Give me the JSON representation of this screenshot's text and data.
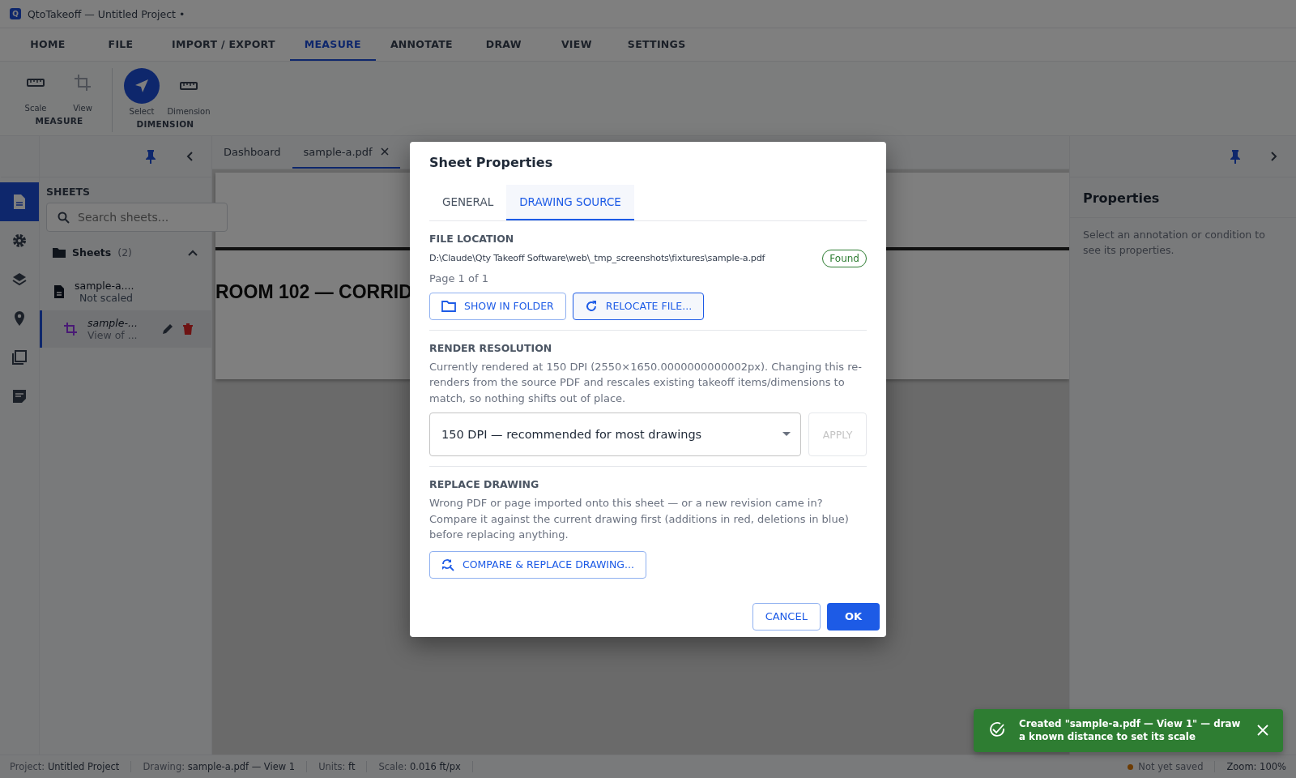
{
  "app": {
    "title": "QtoTakeoff — Untitled Project •",
    "logo": "Q"
  },
  "menu_tabs": [
    {
      "label": "HOME",
      "selected": false
    },
    {
      "label": "FILE",
      "selected": false
    },
    {
      "label": "IMPORT / EXPORT",
      "selected": false
    },
    {
      "label": "MEASURE",
      "selected": true
    },
    {
      "label": "ANNOTATE",
      "selected": false
    },
    {
      "label": "DRAW",
      "selected": false
    },
    {
      "label": "VIEW",
      "selected": false
    },
    {
      "label": "SETTINGS",
      "selected": false
    }
  ],
  "ribbon": [
    {
      "label": "MEASURE",
      "tools": [
        {
          "label": "Scale",
          "kind": "ruler",
          "selected": false,
          "disabled": false
        },
        {
          "label": "View",
          "kind": "crop",
          "selected": false,
          "disabled": true
        }
      ]
    },
    {
      "label": "DIMENSION",
      "tools": [
        {
          "label": "Select",
          "kind": "pointer",
          "selected": true,
          "disabled": false
        },
        {
          "label": "Dimension",
          "kind": "ruler",
          "selected": false,
          "disabled": false
        }
      ]
    }
  ],
  "left_rail": [
    {
      "kind": "document",
      "selected": true
    },
    {
      "kind": "gear",
      "selected": false
    },
    {
      "kind": "layers",
      "selected": false
    },
    {
      "kind": "pin",
      "selected": false
    },
    {
      "kind": "copy",
      "selected": false
    },
    {
      "kind": "note",
      "selected": false
    }
  ],
  "sheets_panel": {
    "title": "SHEETS",
    "search": {
      "placeholder": "Search sheets..."
    },
    "group": {
      "label": "Sheets",
      "count": "(2)",
      "expanded": true
    },
    "items": [
      {
        "kind": "file",
        "name": "sample-a....",
        "subtitle": "Not scaled",
        "selected": false
      },
      {
        "kind": "view",
        "name": "sample-...",
        "subtitle": "View of ...",
        "selected": true
      }
    ]
  },
  "doc_tabs": [
    {
      "label": "Dashboard",
      "closable": false,
      "selected": false
    },
    {
      "label": "sample-a.pdf",
      "closable": true,
      "selected": true
    }
  ],
  "canvas": {
    "heading": "ROOM 102 — CORRID"
  },
  "properties_panel": {
    "title": "Properties",
    "hint": "Select an annotation or condition to see its properties."
  },
  "dialog": {
    "title": "Sheet Properties",
    "tabs": [
      {
        "label": "GENERAL",
        "selected": false
      },
      {
        "label": "DRAWING SOURCE",
        "selected": true
      }
    ],
    "file_location": {
      "heading": "FILE LOCATION",
      "path": "D:\\Claude\\Qty Takeoff Software\\web\\_tmp_screenshots\\fixtures\\sample-a.pdf",
      "status": "Found",
      "page": "Page 1 of 1",
      "buttons": [
        {
          "kind": "folder",
          "label": "SHOW IN FOLDER"
        },
        {
          "kind": "refresh",
          "label": "RELOCATE FILE..."
        }
      ]
    },
    "render_resolution": {
      "heading": "RENDER RESOLUTION",
      "text": "Currently rendered at 150 DPI (2550×1650.0000000000002px). Changing this re-renders from the source PDF and rescales existing takeoff items/dimensions to match, so nothing shifts out of place.",
      "select_value": "150 DPI — recommended for most drawings",
      "apply": {
        "label": "APPLY",
        "disabled": true
      }
    },
    "replace_drawing": {
      "heading": "REPLACE DRAWING",
      "text": "Wrong PDF or page imported onto this sheet — or a new revision came in? Compare it against the current drawing first (additions in red, deletions in blue) before replacing anything.",
      "button": "COMPARE & REPLACE DRAWING..."
    },
    "cancel": "CANCEL",
    "ok": "OK"
  },
  "status_bar": {
    "fields": [
      {
        "label": "Project:",
        "value": "Untitled Project"
      },
      {
        "label": "Drawing:",
        "value": "sample-a.pdf — View 1"
      },
      {
        "label": "Units:",
        "value": "ft"
      },
      {
        "label": "Scale:",
        "value": "0.016 ft/px"
      }
    ],
    "save_status": {
      "label": "Not yet saved"
    },
    "zoom": "Zoom: 100%"
  },
  "toast": {
    "message": "Created \"sample-a.pdf — View 1\" — draw a known distance to set its scale"
  }
}
